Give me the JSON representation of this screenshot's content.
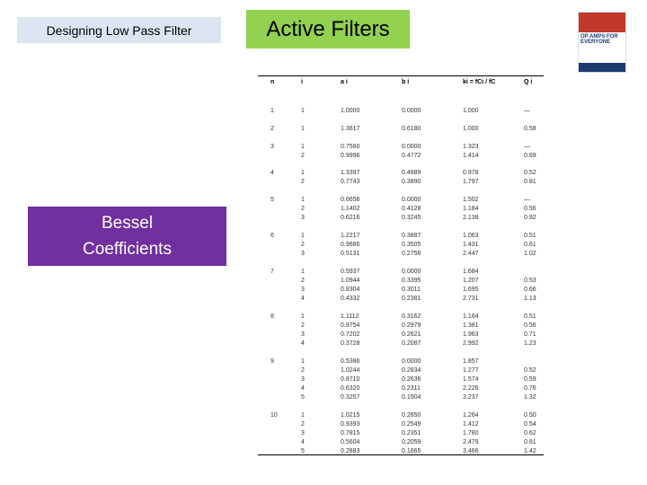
{
  "header": {
    "left_title": "Designing Low Pass Filter",
    "main_title": "Active Filters"
  },
  "side_label": {
    "line1": "Bessel",
    "line2": "Coefficients"
  },
  "book": {
    "title": "OP AMPS FOR EVERYONE"
  },
  "table": {
    "columns": [
      "n",
      "i",
      "a i",
      "b i",
      "ki = fCi / fC",
      "Q i"
    ],
    "groups": [
      {
        "n": "1",
        "rows": [
          [
            "1",
            "1.0000",
            "0.0000",
            "1.000",
            "—"
          ]
        ]
      },
      {
        "n": "2",
        "rows": [
          [
            "1",
            "1.3617",
            "0.6180",
            "1.000",
            "0.58"
          ]
        ]
      },
      {
        "n": "3",
        "rows": [
          [
            "1",
            "0.7560",
            "0.0000",
            "1.323",
            "—"
          ],
          [
            "2",
            "0.9996",
            "0.4772",
            "1.414",
            "0.69"
          ]
        ]
      },
      {
        "n": "4",
        "rows": [
          [
            "1",
            "1.3397",
            "0.4889",
            "0.978",
            "0.52"
          ],
          [
            "2",
            "0.7743",
            "0.3890",
            "1.797",
            "0.81"
          ]
        ]
      },
      {
        "n": "5",
        "rows": [
          [
            "1",
            "0.6656",
            "0.0000",
            "1.502",
            "—"
          ],
          [
            "2",
            "1.1402",
            "0.4128",
            "1.184",
            "0.56"
          ],
          [
            "3",
            "0.6216",
            "0.3245",
            "2.138",
            "0.92"
          ]
        ]
      },
      {
        "n": "6",
        "rows": [
          [
            "1",
            "1.2217",
            "0.3887",
            "1.063",
            "0.51"
          ],
          [
            "2",
            "0.9686",
            "0.3505",
            "1.431",
            "0.61"
          ],
          [
            "3",
            "0.5131",
            "0.2756",
            "2.447",
            "1.02"
          ]
        ]
      },
      {
        "n": "7",
        "rows": [
          [
            "1",
            "0.5937",
            "0.0000",
            "1.684",
            ""
          ],
          [
            "2",
            "1.0944",
            "0.3395",
            "1.207",
            "0.53"
          ],
          [
            "3",
            "0.8304",
            "0.3011",
            "1.695",
            "0.66"
          ],
          [
            "4",
            "0.4332",
            "0.2381",
            "2.731",
            "1.13"
          ]
        ]
      },
      {
        "n": "8",
        "rows": [
          [
            "1",
            "1.1112",
            "0.3162",
            "1.164",
            "0.51"
          ],
          [
            "2",
            "0.9754",
            "0.2979",
            "1.381",
            "0.56"
          ],
          [
            "3",
            "0.7202",
            "0.2621",
            "1.963",
            "0.71"
          ],
          [
            "4",
            "0.3728",
            "0.2087",
            "2.992",
            "1.23"
          ]
        ]
      },
      {
        "n": "9",
        "rows": [
          [
            "1",
            "0.5386",
            "0.0000",
            "1.857",
            ""
          ],
          [
            "2",
            "1.0244",
            "0.2834",
            "1.277",
            "0.52"
          ],
          [
            "3",
            "0.8710",
            "0.2636",
            "1.574",
            "0.59"
          ],
          [
            "4",
            "0.6320",
            "0.2311",
            "2.226",
            "0.76"
          ],
          [
            "5",
            "0.3257",
            "0.1904",
            "3.237",
            "1.32"
          ]
        ]
      },
      {
        "n": "10",
        "rows": [
          [
            "1",
            "1.0215",
            "0.2650",
            "1.264",
            "0.50"
          ],
          [
            "2",
            "0.9393",
            "0.2549",
            "1.412",
            "0.54"
          ],
          [
            "3",
            "0.7815",
            "0.2351",
            "1.780",
            "0.62"
          ],
          [
            "4",
            "0.5604",
            "0.2059",
            "2.479",
            "0.81"
          ],
          [
            "5",
            "0.2883",
            "0.1665",
            "3.466",
            "1.42"
          ]
        ]
      }
    ]
  }
}
